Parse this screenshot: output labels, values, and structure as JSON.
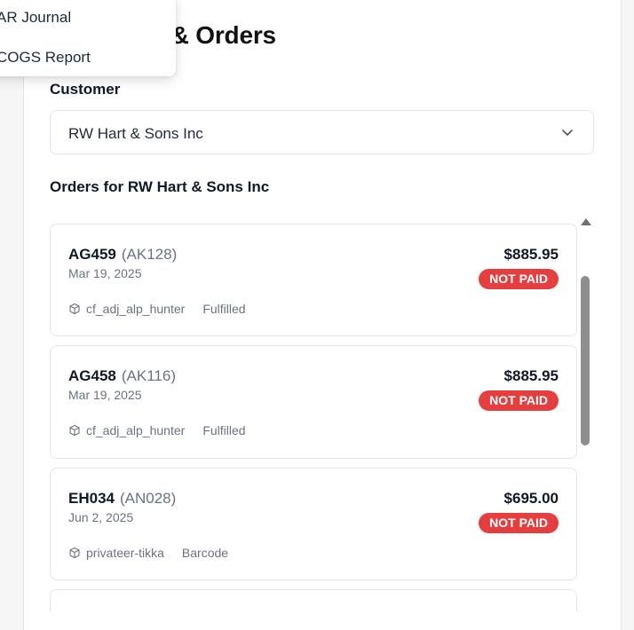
{
  "page": {
    "title": "Customer & Orders"
  },
  "menu": {
    "items": [
      {
        "label": "AR Journal"
      },
      {
        "label": "COGS Report"
      }
    ]
  },
  "customer": {
    "label": "Customer",
    "selected": "RW Hart & Sons Inc",
    "chevron_icon": "chevron-down-icon"
  },
  "orders_section": {
    "title": "Orders for RW Hart & Sons Inc"
  },
  "orders": [
    {
      "number": "AG459",
      "ref": "(AK128)",
      "date": "Mar 19, 2025",
      "amount": "$885.95",
      "status_badge": "NOT PAID",
      "source": "cf_adj_alp_hunter",
      "fulfillment": "Fulfilled"
    },
    {
      "number": "AG458",
      "ref": "(AK116)",
      "date": "Mar 19, 2025",
      "amount": "$885.95",
      "status_badge": "NOT PAID",
      "source": "cf_adj_alp_hunter",
      "fulfillment": "Fulfilled"
    },
    {
      "number": "EH034",
      "ref": "(AN028)",
      "date": "Jun 2, 2025",
      "amount": "$695.00",
      "status_badge": "NOT PAID",
      "source": "privateer-tikka",
      "fulfillment": "Barcode"
    }
  ],
  "colors": {
    "badge_not_paid": "#e53e3e",
    "text_primary": "#111827",
    "text_muted": "#6b7280",
    "border": "#e3e4e8"
  }
}
